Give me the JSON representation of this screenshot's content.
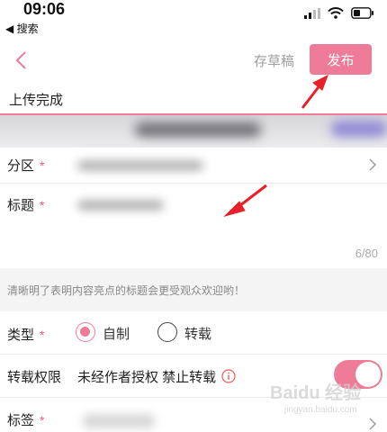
{
  "status_bar": {
    "time": "09:06",
    "back_app_label": "◀ 搜索",
    "icons": [
      "signal-icon",
      "wifi-icon",
      "battery-icon"
    ]
  },
  "nav": {
    "back_icon": "chevron-left-icon",
    "draft_label": "存草稿",
    "publish_label": "发布"
  },
  "upload": {
    "status": "上传完成",
    "progress": 1.0
  },
  "form": {
    "partition": {
      "label": "分区",
      "required_mark": "*"
    },
    "title": {
      "label": "标题",
      "required_mark": "*",
      "char_count": "6/80"
    },
    "tip": "清晰明了表明内容亮点的标题会更受观众欢迎哟！",
    "type": {
      "label": "类型",
      "required_mark": "*",
      "options": [
        {
          "label": "自制",
          "selected": true
        },
        {
          "label": "转载",
          "selected": false
        }
      ]
    },
    "repost_permission": {
      "label": "转载权限",
      "value": "未经作者授权 禁止转载",
      "enabled": true
    },
    "tags": {
      "label": "标签",
      "required_mark": "*"
    }
  },
  "watermark": {
    "text": "Baidu 经验",
    "sub": "jingyan.baidu.com"
  },
  "colors": {
    "accent": "#ee7c99",
    "arrow": "#e8202a",
    "required": "#f05a7e",
    "tip_bg": "#f4f4f4"
  }
}
